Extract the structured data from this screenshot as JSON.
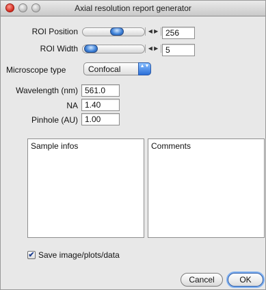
{
  "window": {
    "title": "Axial resolution report generator"
  },
  "roi": {
    "position_label": "ROI Position",
    "position_value": "256",
    "width_label": "ROI Width",
    "width_value": "5"
  },
  "microscope": {
    "label": "Microscope type",
    "selected": "Confocal"
  },
  "params": {
    "wavelength_label": "Wavelength (nm)",
    "wavelength_value": "561.0",
    "na_label": "NA",
    "na_value": "1.40",
    "pinhole_label": "Pinhole (AU)",
    "pinhole_value": "1.00"
  },
  "text_areas": {
    "sample_infos": "Sample infos",
    "comments": "Comments"
  },
  "options": {
    "save_label": "Save image/plots/data",
    "save_checked": true
  },
  "buttons": {
    "cancel": "Cancel",
    "ok": "OK"
  },
  "icons": {
    "arrows": "◀ ▶",
    "popup": "▲▼",
    "check": "✔"
  }
}
